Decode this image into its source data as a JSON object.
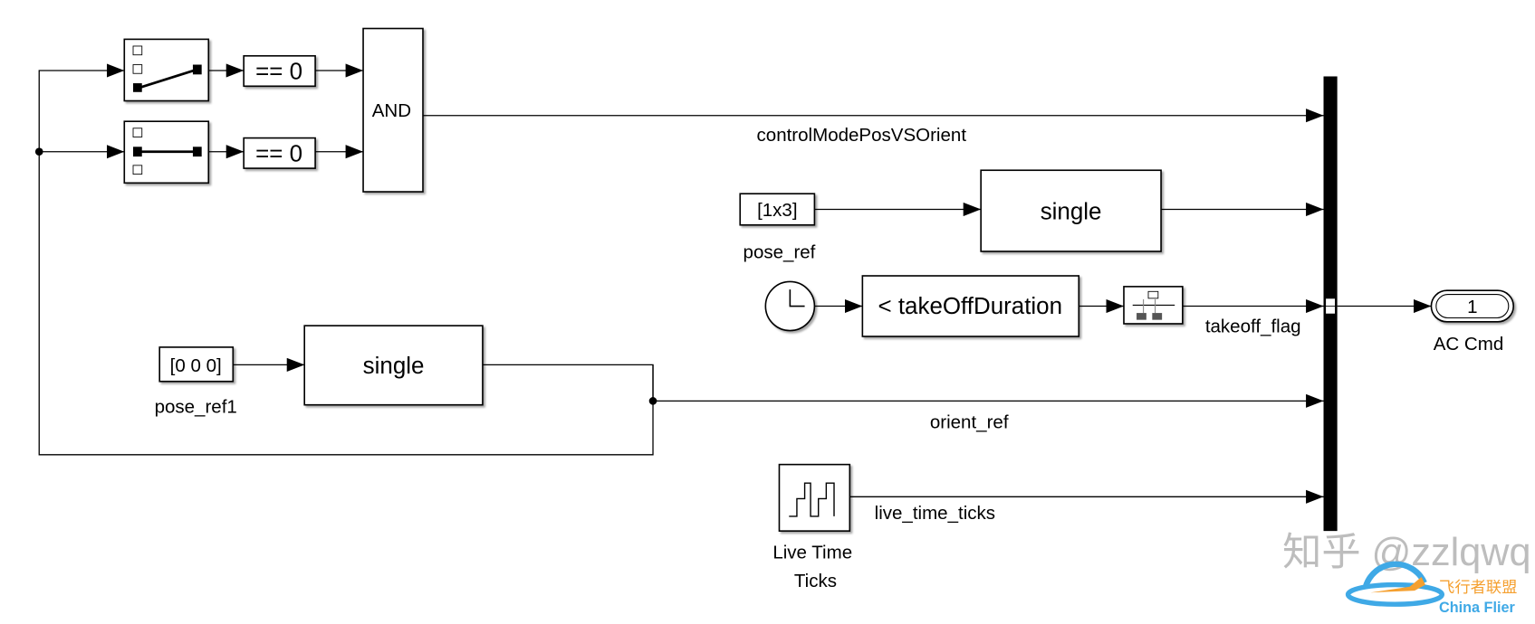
{
  "blocks": {
    "eq0_top": "== 0",
    "eq0_bottom": "== 0",
    "and": "AND",
    "const_pose_ref": "[1x3]",
    "const_pose_ref_name": "pose_ref",
    "single_top": "single",
    "compare": "< takeOffDuration",
    "const_pose_ref1": "[0 0 0]",
    "const_pose_ref1_name": "pose_ref1",
    "single_bottom": "single",
    "outport_number": "1",
    "outport_name": "AC Cmd",
    "live_time_line1": "Live Time",
    "live_time_line2": "Ticks"
  },
  "signals": {
    "control_mode": "controlModePosVSOrient",
    "takeoff_flag": "takeoff_flag",
    "orient_ref": "orient_ref",
    "live_time_ticks": "live_time_ticks"
  },
  "watermark": {
    "text": "知乎 @zzlqwq",
    "logo_cn": "飞行者联盟",
    "logo_en": "China Flier",
    "logo_colors": {
      "ring": "#3fa9e6",
      "plane": "#f5a030"
    }
  }
}
